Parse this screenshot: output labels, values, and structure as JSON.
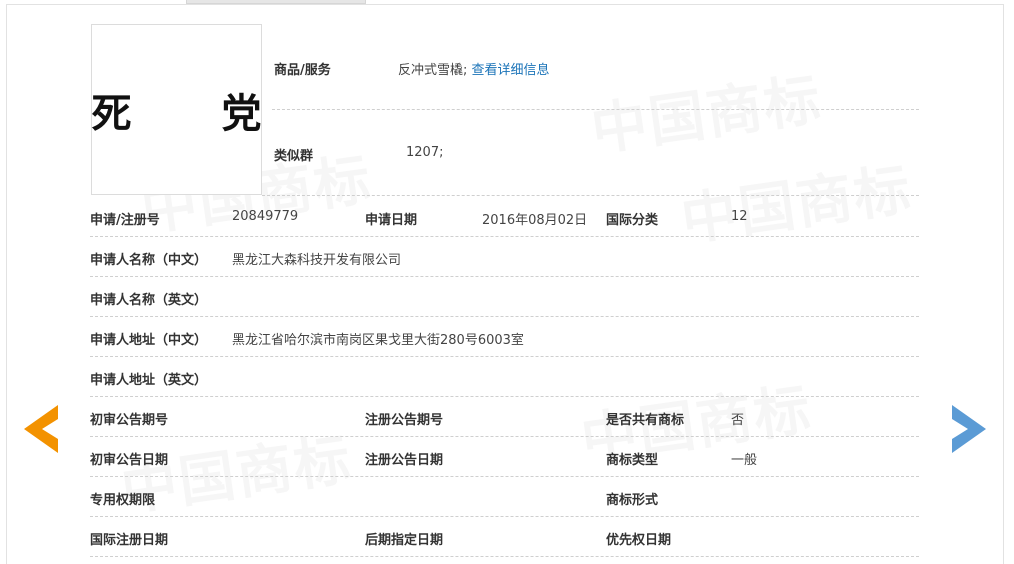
{
  "watermark_text": "中国商标",
  "trademark": {
    "name": "死 党"
  },
  "top": {
    "goods_label": "商品/服务",
    "goods_value": "反冲式雪橇;",
    "goods_link": "查看详细信息",
    "similar_label": "类似群",
    "similar_value": "1207;"
  },
  "rows": [
    {
      "c1_label": "申请/注册号",
      "c1_value": "20849779",
      "c2_label": "申请日期",
      "c2_value": "2016年08月02日",
      "c3_label": "国际分类",
      "c3_value": "12"
    },
    {
      "c1_label": "申请人名称（中文）",
      "c1_value": "黑龙江大森科技开发有限公司"
    },
    {
      "c1_label": "申请人名称（英文）",
      "c1_value": ""
    },
    {
      "c1_label": "申请人地址（中文）",
      "c1_value": "黑龙江省哈尔滨市南岗区果戈里大街280号6003室"
    },
    {
      "c1_label": "申请人地址（英文）",
      "c1_value": ""
    },
    {
      "c1_label": "初审公告期号",
      "c1_value": "",
      "c2_label": "注册公告期号",
      "c2_value": "",
      "c3_label": "是否共有商标",
      "c3_value": "否"
    },
    {
      "c1_label": "初审公告日期",
      "c1_value": "",
      "c2_label": "注册公告日期",
      "c2_value": "",
      "c3_label": "商标类型",
      "c3_value": "一般"
    },
    {
      "c1_label": "专用权期限",
      "c1_value": "",
      "c3_label": "商标形式",
      "c3_value": ""
    },
    {
      "c1_label": "国际注册日期",
      "c1_value": "",
      "c2_label": "后期指定日期",
      "c2_value": "",
      "c3_label": "优先权日期",
      "c3_value": ""
    }
  ],
  "nav": {
    "prev_color": "#f39200",
    "next_color": "#5b9bd5"
  }
}
